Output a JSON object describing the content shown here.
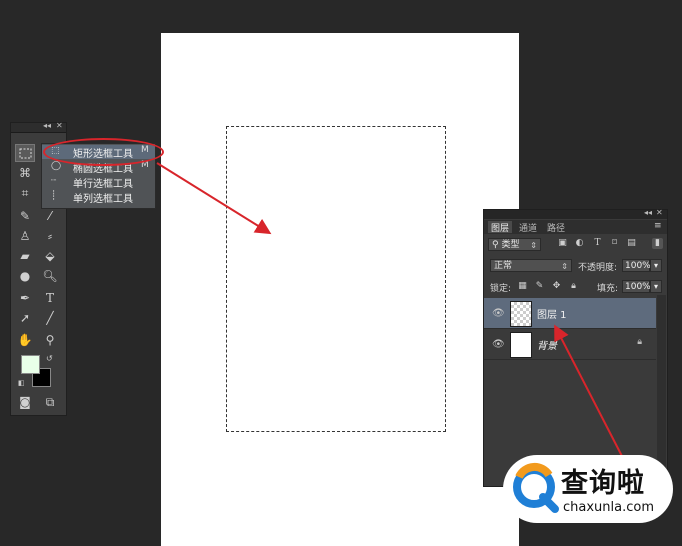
{
  "toolbox": {
    "header_icons": [
      "collapse-icon",
      "close-icon"
    ]
  },
  "flyout": {
    "items": [
      {
        "label": "矩形选框工具",
        "shortcut": "M",
        "selected": true,
        "icon": "rect-marquee-icon"
      },
      {
        "label": "椭圆选框工具",
        "shortcut": "M",
        "selected": false,
        "icon": "ellipse-marquee-icon"
      },
      {
        "label": "单行选框工具",
        "shortcut": "",
        "selected": false,
        "icon": "single-row-marquee-icon"
      },
      {
        "label": "单列选框工具",
        "shortcut": "",
        "selected": false,
        "icon": "single-column-marquee-icon"
      }
    ]
  },
  "layers_panel": {
    "tabs": [
      "图层",
      "通道",
      "路径"
    ],
    "active_tab": "图层",
    "filter_label": "类型",
    "blend_mode": "正常",
    "opacity_label": "不透明度:",
    "opacity_value": "100%",
    "lock_label": "锁定:",
    "fill_label": "填充:",
    "fill_value": "100%",
    "layers": [
      {
        "name": "图层 1",
        "selected": true,
        "thumbnail": "transparent",
        "locked": false
      },
      {
        "name": "背景",
        "selected": false,
        "thumbnail": "white",
        "locked": true
      }
    ]
  },
  "watermark": {
    "brand": "查询啦",
    "domain": "chaxunla.com"
  },
  "colors": {
    "workspace": "#282828",
    "highlight": "#d8252b",
    "selected_layer": "#5e6b7d",
    "foreground_swatch": "#e8ffe8",
    "background_swatch": "#000000",
    "brand_orange": "#f29a1d",
    "brand_blue": "#1f7fd6"
  }
}
